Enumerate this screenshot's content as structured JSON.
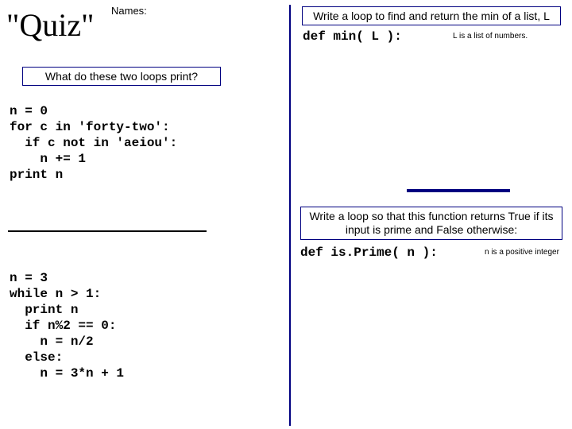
{
  "title": "\"Quiz\"",
  "names_label": "Names:",
  "q1": "What do these two loops print?",
  "q2": "Write a loop to find and return the min of a list, L",
  "q3": "Write a loop so that this function returns True if its input is prime and False otherwise:",
  "code1": "n = 0\nfor c in 'forty-two':\n  if c not in 'aeiou':\n    n += 1\nprint n",
  "code2": "n = 3\nwhile n > 1:\n  print n\n  if n%2 == 0:\n    n = n/2\n  else:\n    n = 3*n + 1",
  "def_min": "def min( L ):",
  "def_prime": "def is.Prime( n ):",
  "hint_min": "L is a list of numbers.",
  "hint_prime": "n is a positive integer"
}
